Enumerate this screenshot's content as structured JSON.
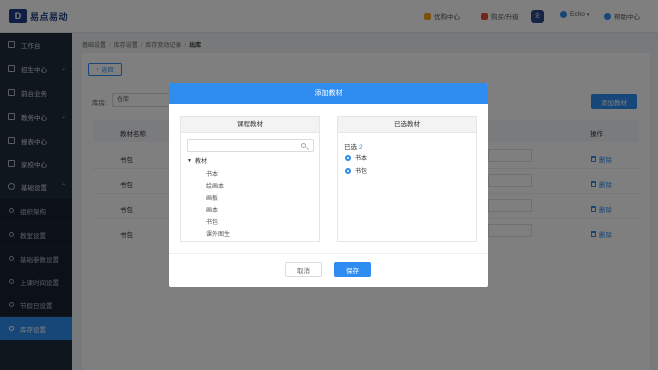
{
  "brand": {
    "name": "易点易动",
    "mark": "D"
  },
  "header": {
    "items": [
      {
        "label": "优购中心",
        "icon": "shop-icon",
        "color": "#f5a623"
      },
      {
        "label": "购买/升级",
        "icon": "upgrade-icon",
        "color": "#e74c3c"
      },
      {
        "label": "Echo",
        "icon": "user-icon",
        "color": "#2f8cf0"
      },
      {
        "label": "帮助中心",
        "icon": "help-icon",
        "color": "#2f8cf0"
      }
    ],
    "avatar_text": "企"
  },
  "sidebar": {
    "items": [
      {
        "label": "工作台",
        "icon": "dashboard-icon",
        "chevron": ""
      },
      {
        "label": "招生中心",
        "icon": "enroll-icon",
        "chevron": "⌄"
      },
      {
        "label": "前台业务",
        "icon": "front-desk-icon",
        "chevron": ""
      },
      {
        "label": "教务中心",
        "icon": "academic-icon",
        "chevron": "⌄"
      },
      {
        "label": "报表中心",
        "icon": "report-icon",
        "chevron": ""
      },
      {
        "label": "家校中心",
        "icon": "home-school-icon",
        "chevron": ""
      },
      {
        "label": "基础设置",
        "icon": "gear-icon",
        "chevron": "⌃"
      }
    ],
    "sub_items": [
      {
        "label": "组织架构"
      },
      {
        "label": "教室设置"
      },
      {
        "label": "基础参数设置"
      },
      {
        "label": "上课时间设置"
      },
      {
        "label": "节假日设置"
      },
      {
        "label": "库存设置"
      }
    ]
  },
  "breadcrumb": [
    "基础设置",
    "库存设置",
    "库存变动记录",
    "出库"
  ],
  "main": {
    "back_label": "返回",
    "warehouse_label": "库房:",
    "warehouse_value": "仓库",
    "add_button": "添加教材",
    "columns": {
      "name": "教材名称",
      "op": "操作"
    },
    "rows": [
      {
        "name": "书包",
        "action": "删除"
      },
      {
        "name": "书包",
        "action": "删除"
      },
      {
        "name": "书包",
        "action": "删除"
      },
      {
        "name": "书包",
        "action": "删除"
      }
    ]
  },
  "modal": {
    "title": "添加教材",
    "left_title": "课程教材",
    "search_placeholder": "",
    "tree_root": "教材",
    "tree_items": [
      "书本",
      "绘画本",
      "画板",
      "画本",
      "书包",
      "课外图生"
    ],
    "right_title": "已选教材",
    "selected_label": "已选",
    "selected_count": "2",
    "selected_items": [
      "书本",
      "书包"
    ],
    "cancel": "取消",
    "save": "保存"
  },
  "colors": {
    "accent": "#2f8cf0",
    "sidebar": "#1f2d3d",
    "brand": "#1e3f87"
  }
}
